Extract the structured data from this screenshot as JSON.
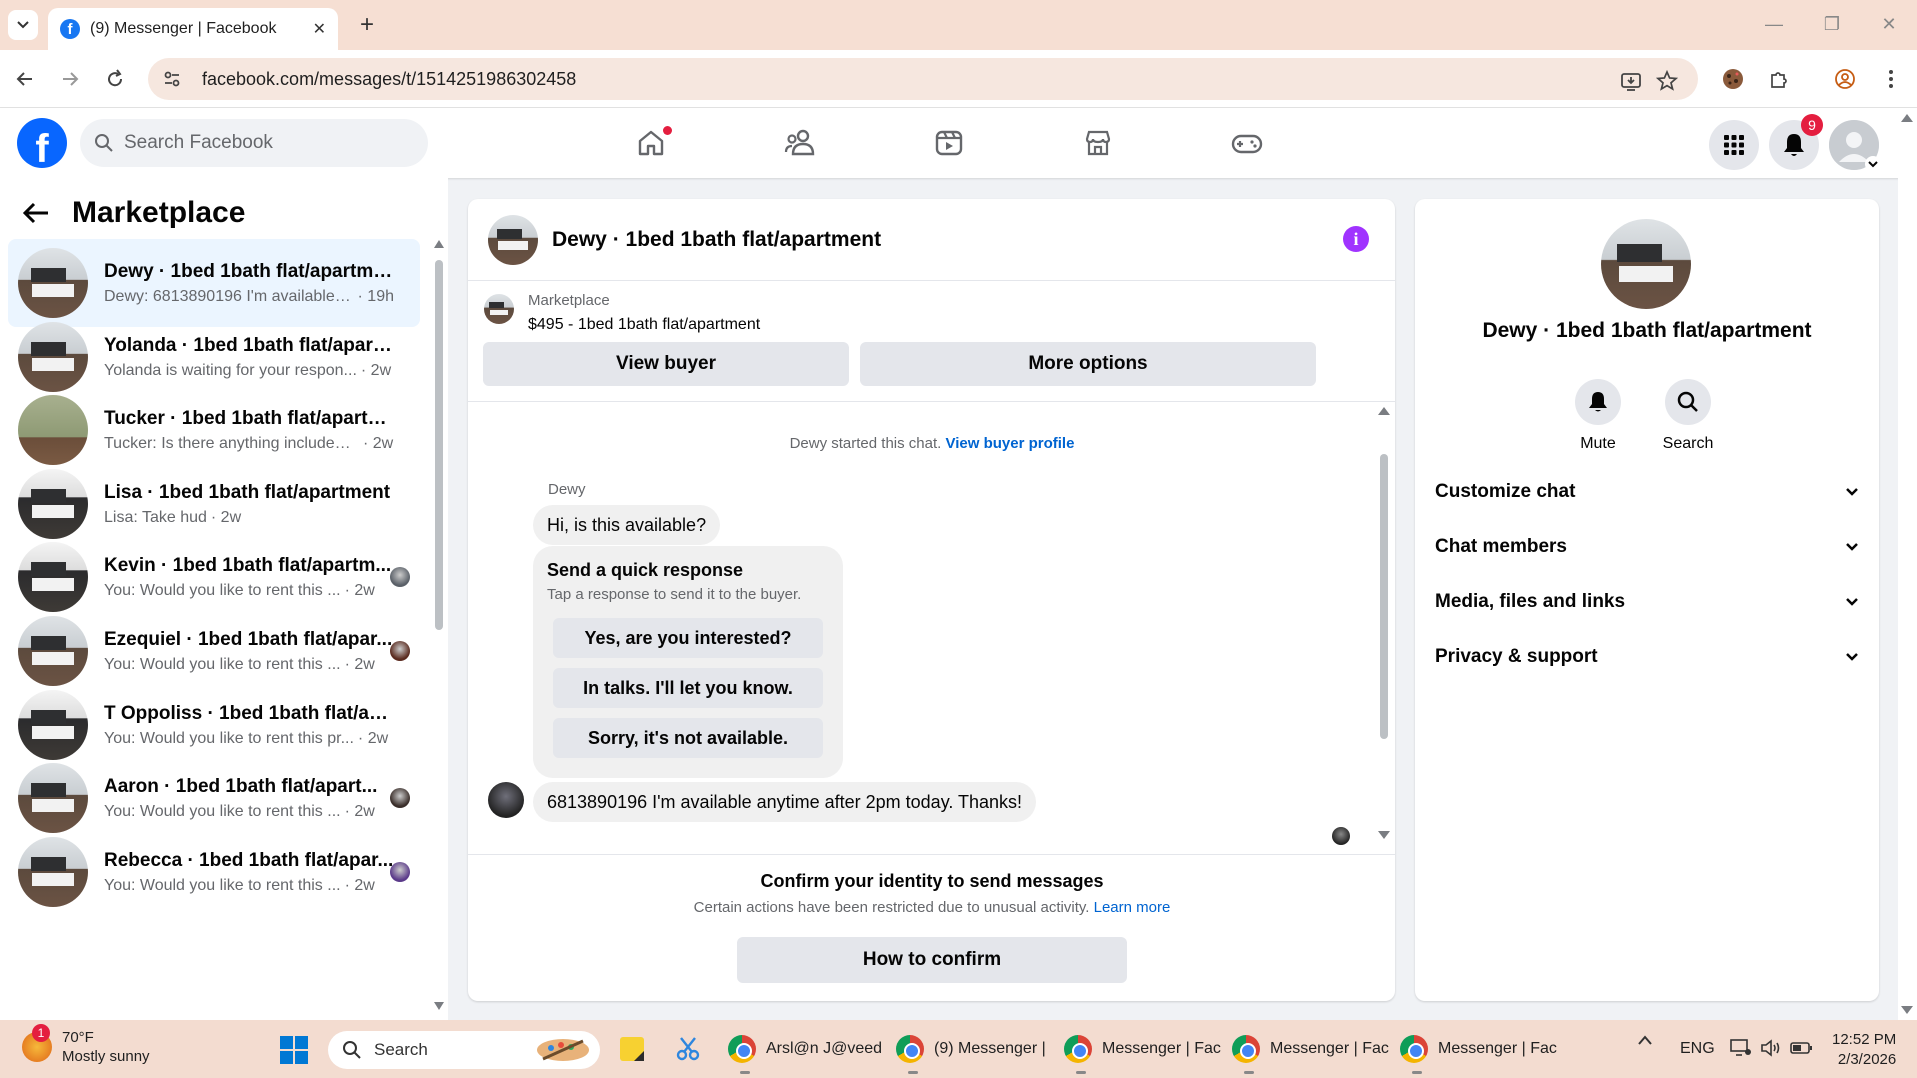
{
  "browser": {
    "tab_title": "(9) Messenger | Facebook",
    "url": "facebook.com/messages/t/1514251986302458"
  },
  "fbnav": {
    "search_placeholder": "Search Facebook",
    "notification_count": "9"
  },
  "sidebar": {
    "title": "Marketplace",
    "conversations": [
      {
        "name": "Dewy · 1bed 1bath flat/apartment",
        "preview": "Dewy: 6813890196 I'm available a...",
        "time": "· 19h",
        "thumb": "room",
        "seen": false,
        "active": true
      },
      {
        "name": "Yolanda · 1bed 1bath flat/apartm...",
        "preview": "Yolanda is waiting for your respon...",
        "time": "· 2w",
        "thumb": "room",
        "seen": false,
        "active": false
      },
      {
        "name": "Tucker · 1bed 1bath flat/apartme...",
        "preview": "Tucker: Is there anything included ...",
        "time": "· 2w",
        "thumb": "green",
        "seen": false,
        "active": false
      },
      {
        "name": "Lisa · 1bed 1bath flat/apartment",
        "preview": "Lisa: Take hud",
        "time": "· 2w",
        "thumb": "dark",
        "seen": false,
        "active": false
      },
      {
        "name": "Kevin · 1bed 1bath flat/apartm...",
        "preview": "You: Would you like to rent this ...",
        "time": "· 2w",
        "thumb": "dark",
        "seen": true,
        "seen_color": "#5a6068",
        "active": false
      },
      {
        "name": "Ezequiel · 1bed 1bath flat/apar...",
        "preview": "You: Would you like to rent this ...",
        "time": "· 2w",
        "thumb": "room",
        "seen": true,
        "seen_color": "#5a2a1e",
        "active": false
      },
      {
        "name": "T Oppoliss · 1bed 1bath flat/apar...",
        "preview": "You: Would you like to rent this pr...",
        "time": "· 2w",
        "thumb": "dark",
        "seen": false,
        "active": false
      },
      {
        "name": "Aaron · 1bed 1bath flat/apart...",
        "preview": "You: Would you like to rent this ...",
        "time": "· 2w",
        "thumb": "room",
        "seen": true,
        "seen_color": "#3a2e2a",
        "active": false
      },
      {
        "name": "Rebecca · 1bed 1bath flat/apar...",
        "preview": "You: Would you like to rent this ...",
        "time": "· 2w",
        "thumb": "room",
        "seen": true,
        "seen_color": "#5b3a8a",
        "active": false
      }
    ]
  },
  "chat": {
    "title": "Dewy · 1bed 1bath flat/apartment",
    "listing_source": "Marketplace",
    "listing_title": "$495 - 1bed 1bath flat/apartment",
    "view_buyer": "View buyer",
    "more_options": "More options",
    "started_text": "Dewy started this chat.",
    "started_link": "View buyer profile",
    "sender": "Dewy",
    "msg1": "Hi, is this available?",
    "quick_title": "Send a quick response",
    "quick_sub": "Tap a response to send it to the buyer.",
    "quick_options": [
      "Yes, are you interested?",
      "In talks. I'll let you know.",
      "Sorry, it's not available."
    ],
    "msg2": "6813890196 I'm available anytime after 2pm today. Thanks!",
    "confirm_title": "Confirm your identity to send messages",
    "confirm_desc": "Certain actions have been restricted due to unusual activity.",
    "confirm_link": "Learn more",
    "confirm_button": "How to confirm"
  },
  "panel": {
    "name": "Dewy · 1bed 1bath flat/apartment",
    "mute": "Mute",
    "search": "Search",
    "sections": [
      "Customize chat",
      "Chat members",
      "Media, files and links",
      "Privacy & support"
    ]
  },
  "taskbar": {
    "weather_temp": "70°F",
    "weather_desc": "Mostly sunny",
    "weather_badge": "1",
    "search": "Search",
    "apps": [
      "Arsl@n J@veed",
      "(9) Messenger |",
      "Messenger | Fac",
      "Messenger | Fac",
      "Messenger | Fac"
    ],
    "lang": "ENG",
    "time": "12:52 PM",
    "date": "2/3/2026"
  },
  "colors": {
    "fb_blue": "#0866ff",
    "link_blue": "#0064d1",
    "info_purple": "#a033ff",
    "active_row": "#ebf5ff",
    "notification_red": "#e41e3f"
  }
}
